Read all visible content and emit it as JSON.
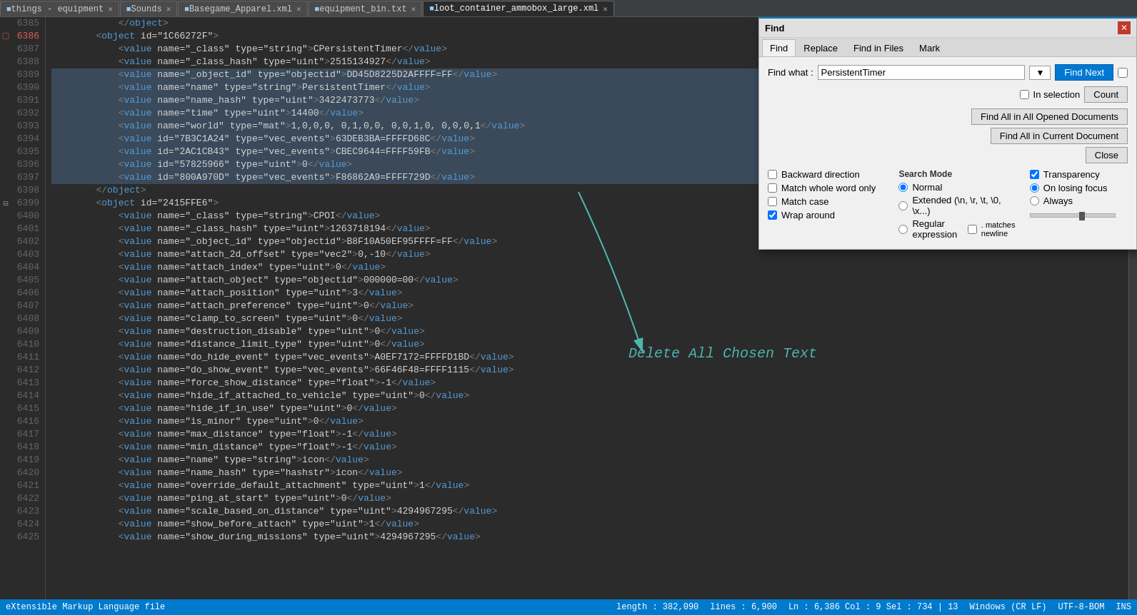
{
  "tabs": [
    {
      "label": "things - equipment",
      "icon": "file",
      "active": false,
      "closable": true
    },
    {
      "label": "Sounds",
      "icon": "file",
      "active": false,
      "closable": true
    },
    {
      "label": "Basegame_Apparel.xml",
      "icon": "file",
      "active": false,
      "closable": true
    },
    {
      "label": "equipment_bin.txt",
      "icon": "file",
      "active": false,
      "closable": true
    },
    {
      "label": "loot_container_ammobox_large.xml",
      "icon": "file",
      "active": true,
      "closable": true
    }
  ],
  "lines": [
    {
      "num": 6385,
      "indent": "            ",
      "content": "</object>",
      "type": "closing"
    },
    {
      "num": 6386,
      "indent": "        ",
      "content": "<object id=\"1C66272F\">",
      "type": "opening",
      "marker": "bookmark"
    },
    {
      "num": 6387,
      "indent": "            ",
      "content": "<value name=\"_class\" type=\"string\">CPersistentTimer</value>",
      "type": "value"
    },
    {
      "num": 6388,
      "indent": "            ",
      "content": "<value name=\"_class_hash\" type=\"uint\">2515134927</value>",
      "type": "value"
    },
    {
      "num": 6389,
      "indent": "            ",
      "content": "<value name=\"_object_id\" type=\"objectid\">DD45D8225D2AFFFF=FF</value>",
      "type": "value",
      "selected": true
    },
    {
      "num": 6390,
      "indent": "            ",
      "content": "<value name=\"name\" type=\"string\">PersistentTimer</value>",
      "type": "value",
      "selected": true
    },
    {
      "num": 6391,
      "indent": "            ",
      "content": "<value name=\"name_hash\" type=\"uint\">3422473773</value>",
      "type": "value",
      "selected": true
    },
    {
      "num": 6392,
      "indent": "            ",
      "content": "<value name=\"time\" type=\"uint\">14400</value>",
      "type": "value",
      "selected": true
    },
    {
      "num": 6393,
      "indent": "            ",
      "content": "<value name=\"world\" type=\"mat\">1,0,0,0, 0,1,0,0, 0,0,1,0, 0,0,0,1</value>",
      "type": "value",
      "selected": true
    },
    {
      "num": 6394,
      "indent": "            ",
      "content": "<value id=\"7B3C1A24\" type=\"vec_events\">63DEB3BA=FFFFD68C</value>",
      "type": "value",
      "selected": true
    },
    {
      "num": 6395,
      "indent": "            ",
      "content": "<value id=\"2AC1CB43\" type=\"vec_events\">CBEC9644=FFFF59FB</value>",
      "type": "value",
      "selected": true
    },
    {
      "num": 6396,
      "indent": "            ",
      "content": "<value id=\"57825966\" type=\"uint\">0</value>",
      "type": "value",
      "selected": true
    },
    {
      "num": 6397,
      "indent": "            ",
      "content": "<value id=\"800A970D\" type=\"vec_events\">F86862A9=FFFF729D</value>",
      "type": "value",
      "selected": true
    },
    {
      "num": 6398,
      "indent": "        ",
      "content": "</object>",
      "type": "closing"
    },
    {
      "num": 6399,
      "indent": "        ",
      "content": "<object id=\"2415FFE6\">",
      "type": "opening",
      "marker": "fold"
    },
    {
      "num": 6400,
      "indent": "            ",
      "content": "<value name=\"_class\" type=\"string\">CPOI</value>",
      "type": "value"
    },
    {
      "num": 6401,
      "indent": "            ",
      "content": "<value name=\"_class_hash\" type=\"uint\">1263718194</value>",
      "type": "value"
    },
    {
      "num": 6402,
      "indent": "            ",
      "content": "<value name=\"_object_id\" type=\"objectid\">B8F10A50EF95FFFF=FF</value>",
      "type": "value"
    },
    {
      "num": 6403,
      "indent": "            ",
      "content": "<value name=\"attach_2d_offset\" type=\"vec2\">0,-10</value>",
      "type": "value"
    },
    {
      "num": 6404,
      "indent": "            ",
      "content": "<value name=\"attach_index\" type=\"uint\">0</value>",
      "type": "value"
    },
    {
      "num": 6405,
      "indent": "            ",
      "content": "<value name=\"attach_object\" type=\"objectid\">000000=00</value>",
      "type": "value"
    },
    {
      "num": 6406,
      "indent": "            ",
      "content": "<value name=\"attach_position\" type=\"uint\">3</value>",
      "type": "value"
    },
    {
      "num": 6407,
      "indent": "            ",
      "content": "<value name=\"attach_preference\" type=\"uint\">0</value>",
      "type": "value"
    },
    {
      "num": 6408,
      "indent": "            ",
      "content": "<value name=\"clamp_to_screen\" type=\"uint\">0</value>",
      "type": "value"
    },
    {
      "num": 6409,
      "indent": "            ",
      "content": "<value name=\"destruction_disable\" type=\"uint\">0</value>",
      "type": "value"
    },
    {
      "num": 6410,
      "indent": "            ",
      "content": "<value name=\"distance_limit_type\" type=\"uint\">0</value>",
      "type": "value"
    },
    {
      "num": 6411,
      "indent": "            ",
      "content": "<value name=\"do_hide_event\" type=\"vec_events\">A0EF7172=FFFFD1BD</value>",
      "type": "value"
    },
    {
      "num": 6412,
      "indent": "            ",
      "content": "<value name=\"do_show_event\" type=\"vec_events\">66F46F48=FFFF1115</value>",
      "type": "value"
    },
    {
      "num": 6413,
      "indent": "            ",
      "content": "<value name=\"force_show_distance\" type=\"float\">-1</value>",
      "type": "value"
    },
    {
      "num": 6414,
      "indent": "            ",
      "content": "<value name=\"hide_if_attached_to_vehicle\" type=\"uint\">0</value>",
      "type": "value"
    },
    {
      "num": 6415,
      "indent": "            ",
      "content": "<value name=\"hide_if_in_use\" type=\"uint\">0</value>",
      "type": "value"
    },
    {
      "num": 6416,
      "indent": "            ",
      "content": "<value name=\"is_minor\" type=\"uint\">0</value>",
      "type": "value"
    },
    {
      "num": 6417,
      "indent": "            ",
      "content": "<value name=\"max_distance\" type=\"float\">-1</value>",
      "type": "value"
    },
    {
      "num": 6418,
      "indent": "            ",
      "content": "<value name=\"min_distance\" type=\"float\">-1</value>",
      "type": "value"
    },
    {
      "num": 6419,
      "indent": "            ",
      "content": "<value name=\"name\" type=\"string\">icon</value>",
      "type": "value"
    },
    {
      "num": 6420,
      "indent": "            ",
      "content": "<value name=\"name_hash\" type=\"hashstr\">icon</value>",
      "type": "value"
    },
    {
      "num": 6421,
      "indent": "            ",
      "content": "<value name=\"override_default_attachment\" type=\"uint\">1</value>",
      "type": "value"
    },
    {
      "num": 6422,
      "indent": "            ",
      "content": "<value name=\"ping_at_start\" type=\"uint\">0</value>",
      "type": "value"
    },
    {
      "num": 6423,
      "indent": "            ",
      "content": "<value name=\"scale_based_on_distance\" type=\"uint\">4294967295</value>",
      "type": "value"
    },
    {
      "num": 6424,
      "indent": "            ",
      "content": "<value name=\"show_before_attach\" type=\"uint\">1</value>",
      "type": "value"
    },
    {
      "num": 6425,
      "indent": "            ",
      "content": "<value name=\"show_during_missions\" type=\"uint\">4294967295</value>",
      "type": "value"
    }
  ],
  "find_dialog": {
    "title": "Find",
    "tabs": [
      "Find",
      "Replace",
      "Find in Files",
      "Mark"
    ],
    "active_tab": "Find",
    "find_what_label": "Find what :",
    "find_what_value": "PersistentTimer",
    "in_selection_label": "In selection",
    "buttons": {
      "find_next": "Find Next",
      "count": "Count",
      "find_all_opened": "Find All in All Opened Documents",
      "find_all_current": "Find All in Current Document",
      "close": "Close"
    },
    "checkboxes": {
      "backward_direction": {
        "label": "Backward direction",
        "checked": false
      },
      "match_whole_word": {
        "label": "Match whole word only",
        "checked": false
      },
      "match_case": {
        "label": "Match case",
        "checked": false
      },
      "wrap_around": {
        "label": "Wrap around",
        "checked": true
      }
    },
    "search_mode": {
      "label": "Search Mode",
      "options": [
        "Normal",
        "Extended (\\n, \\r, \\t, \\0, \\x...)",
        "Regular expression"
      ],
      "selected": "Normal",
      "matches_newline": ". matches newline"
    },
    "transparency": {
      "label": "Transparency",
      "options": [
        "On losing focus",
        "Always"
      ],
      "selected": "On losing focus"
    }
  },
  "annotation": {
    "text": "Delete All Chosen Text",
    "color": "#4db6ac"
  },
  "status_bar": {
    "file_type": "eXtensible Markup Language file",
    "length": "length : 382,090",
    "lines": "lines : 6,900",
    "position": "Ln : 6,386  Col : 9  Sel : 734 | 13",
    "line_ending": "Windows (CR LF)",
    "encoding": "UTF-8-BOM",
    "mode": "INS"
  }
}
